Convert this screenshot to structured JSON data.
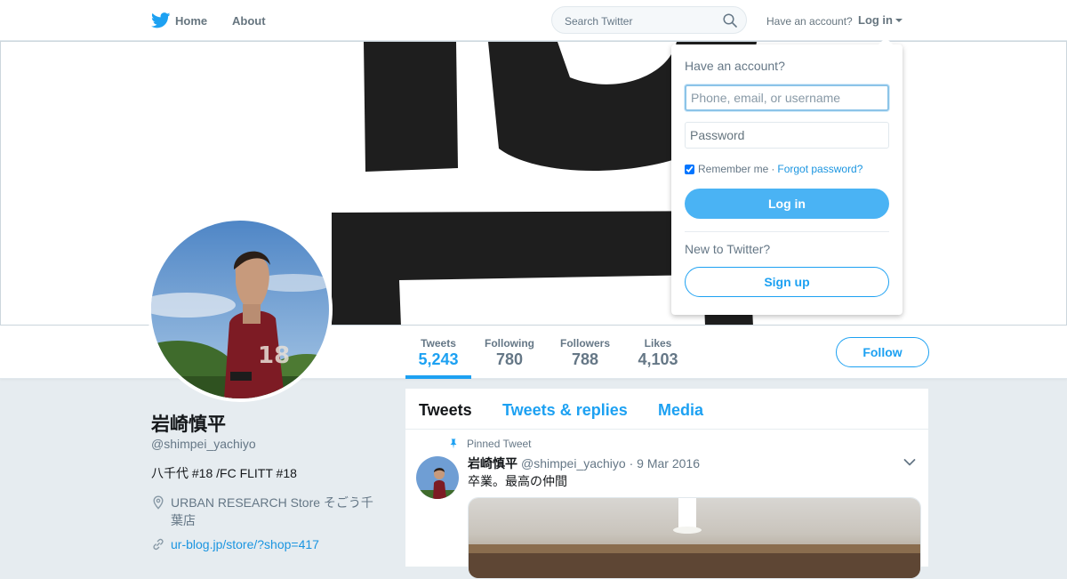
{
  "nav": {
    "home_label": "Home",
    "about_label": "About",
    "search_placeholder": "Search Twitter",
    "have_account_text": "Have an account?",
    "login_label": "Log in"
  },
  "profile_nav": {
    "stats": [
      {
        "label": "Tweets",
        "value": "5,243",
        "active": true
      },
      {
        "label": "Following",
        "value": "780"
      },
      {
        "label": "Followers",
        "value": "788"
      },
      {
        "label": "Likes",
        "value": "4,103"
      }
    ],
    "follow_label": "Follow"
  },
  "profile": {
    "name": "岩崎慎平",
    "handle": "@shimpei_yachiyo",
    "bio": "八千代 #18 /FC FLITT #18",
    "location": "URBAN RESEARCH Store そごう千葉店",
    "url": "ur-blog.jp/store/?shop=417"
  },
  "timeline": {
    "tabs": [
      "Tweets",
      "Tweets & replies",
      "Media"
    ],
    "pinned_label": "Pinned Tweet",
    "tweet": {
      "name": "岩崎慎平",
      "handle": "@shimpei_yachiyo",
      "separator": "·",
      "date": "9 Mar 2016",
      "text": "卒業。最高の仲間"
    }
  },
  "login_dropdown": {
    "title": "Have an account?",
    "username_placeholder": "Phone, email, or username",
    "password_placeholder": "Password",
    "remember_label": "Remember me",
    "remember_separator": "·",
    "forgot_label": "Forgot password?",
    "login_button": "Log in",
    "new_label": "New to Twitter?",
    "signup_button": "Sign up"
  },
  "colors": {
    "brand_blue": "#1da1f2",
    "login_button": "#4ab3f4",
    "background": "#e6ecf0"
  },
  "icons": [
    "twitter-bird-icon",
    "search-icon",
    "caret-down-icon",
    "location-pin-icon",
    "link-icon",
    "pin-icon",
    "chevron-down-icon"
  ]
}
